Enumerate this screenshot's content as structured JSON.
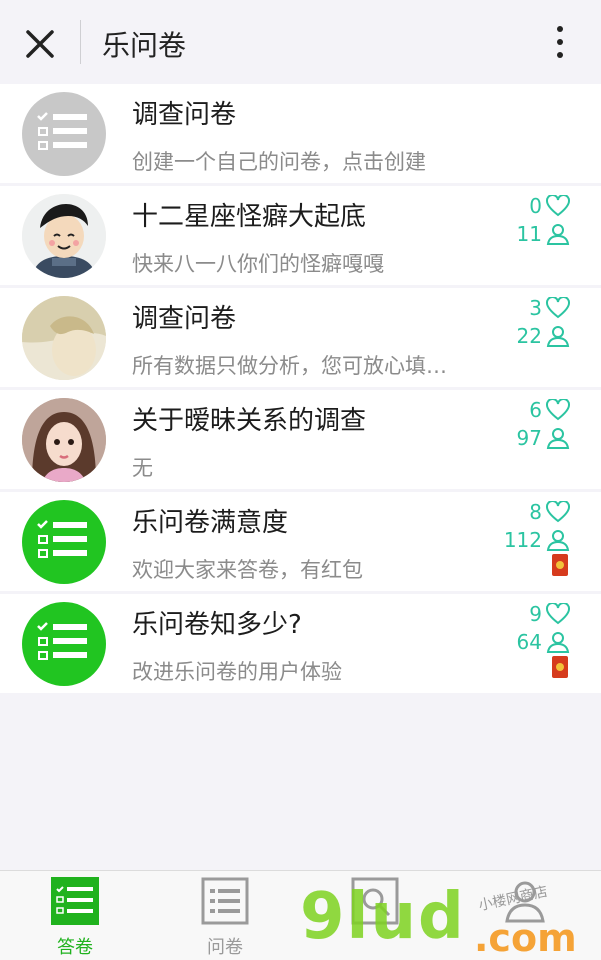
{
  "header": {
    "title": "乐问卷"
  },
  "icons": {
    "close": "close-icon",
    "more": "more-vertical-icon",
    "like": "heart-icon",
    "user": "person-icon",
    "redbag": "red-envelope-icon",
    "survey": "checklist-icon"
  },
  "colors": {
    "accent": "#2bc4a1",
    "green": "#21c521",
    "gray_avatar": "#c8c8c8",
    "active_tab": "#20b21e"
  },
  "surveys": [
    {
      "title": "调查问卷",
      "subtitle": "创建一个自己的问卷，点击创建",
      "likes": "",
      "users": "",
      "avatar": "gray-checklist"
    },
    {
      "title": "十二星座怪癖大起底",
      "subtitle": "快来八一八你们的怪癖嘎嘎",
      "likes": "0",
      "users": "11",
      "avatar": "cartoon-boy"
    },
    {
      "title": "调查问卷",
      "subtitle": "所有数据只做分析，您可放心填…",
      "likes": "3",
      "users": "22",
      "avatar": "photo-girl-blond"
    },
    {
      "title": "关于暧昧关系的调查",
      "subtitle": "无",
      "likes": "6",
      "users": "97",
      "avatar": "photo-girl-selfie"
    },
    {
      "title": "乐问卷满意度",
      "subtitle": "欢迎大家来答卷，有红包",
      "likes": "8",
      "users": "112",
      "avatar": "green-checklist",
      "red_envelope": true
    },
    {
      "title": "乐问卷知多少?",
      "subtitle": "改进乐问卷的用户体验",
      "likes": "9",
      "users": "64",
      "avatar": "green-checklist",
      "red_envelope": true
    }
  ],
  "tabs": [
    {
      "label": "答卷",
      "active": true
    },
    {
      "label": "问卷",
      "active": false
    },
    {
      "label": "",
      "active": false
    },
    {
      "label": "",
      "active": false
    }
  ],
  "watermark": {
    "main": "9lud",
    "suffix": ".com",
    "small": "小楼网商店"
  }
}
